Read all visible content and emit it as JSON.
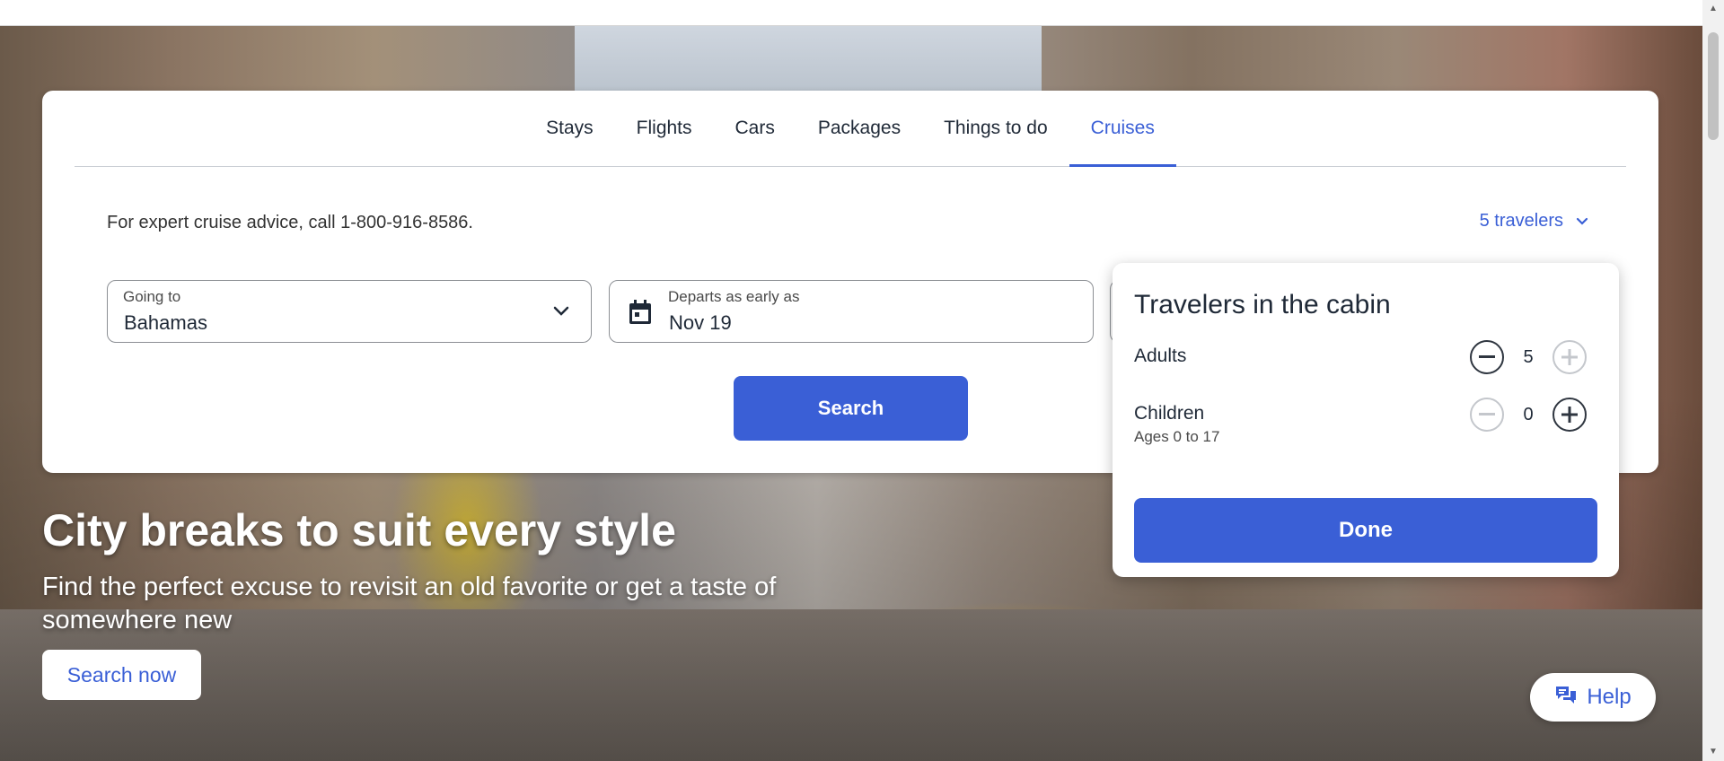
{
  "tabs": [
    {
      "label": "Stays"
    },
    {
      "label": "Flights"
    },
    {
      "label": "Cars"
    },
    {
      "label": "Packages"
    },
    {
      "label": "Things to do"
    },
    {
      "label": "Cruises",
      "active": true
    }
  ],
  "search": {
    "advice": "For expert cruise advice, call 1-800-916-8586.",
    "travelers_summary": "5 travelers",
    "going_to": {
      "label": "Going to",
      "value": "Bahamas"
    },
    "departs": {
      "label": "Departs as early as",
      "value": "Nov 19"
    },
    "search_button": "Search"
  },
  "travelers_popover": {
    "title": "Travelers in the cabin",
    "adults": {
      "label": "Adults",
      "value": "5"
    },
    "children": {
      "label": "Children",
      "sublabel": "Ages 0 to 17",
      "value": "0"
    },
    "done_button": "Done"
  },
  "promo": {
    "title": "City breaks to suit every style",
    "subtitle": "Find the perfect excuse to revisit an old favorite or get a taste of somewhere new",
    "button": "Search now"
  },
  "help": {
    "label": "Help"
  },
  "colors": {
    "accent": "#3a5fd6",
    "text": "#1f2937"
  },
  "icons": [
    "chevron-down-icon",
    "calendar-icon",
    "minus-icon",
    "plus-icon",
    "chat-icon"
  ]
}
